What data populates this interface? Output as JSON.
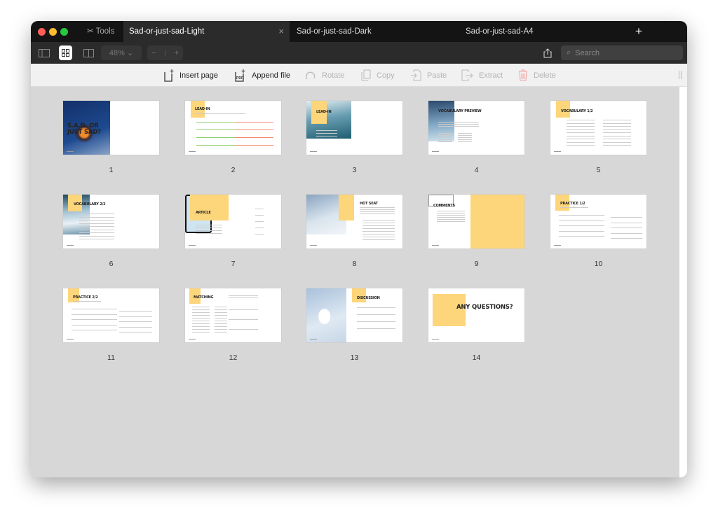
{
  "window": {
    "tabs": [
      {
        "label": "Tools",
        "icon": "tools-icon"
      },
      {
        "label": "Sad-or-just-sad-Light",
        "active": true
      },
      {
        "label": "Sad-or-just-sad-Dark"
      },
      {
        "label": "Sad-or-just-sad-A4"
      }
    ],
    "new_tab": "+",
    "close_tab": "×"
  },
  "toolbar": {
    "zoom": "48%",
    "zoom_out": "−",
    "zoom_in": "+",
    "search_placeholder": "Search",
    "view_mode": "grid"
  },
  "actions": [
    {
      "label": "Insert page",
      "icon": "insert-page-icon",
      "enabled": true
    },
    {
      "label": "Append file",
      "icon": "append-pdf-icon",
      "enabled": true
    },
    {
      "label": "Rotate",
      "icon": "rotate-icon",
      "enabled": false
    },
    {
      "label": "Copy",
      "icon": "copy-icon",
      "enabled": false
    },
    {
      "label": "Paste",
      "icon": "paste-icon",
      "enabled": false
    },
    {
      "label": "Extract",
      "icon": "extract-icon",
      "enabled": false
    },
    {
      "label": "Delete",
      "icon": "trash-icon",
      "enabled": false
    }
  ],
  "colors": {
    "accent_yellow": "#fdd57a",
    "delete_red": "#f3a3a3"
  },
  "pages": [
    {
      "number": "1",
      "title": "S.A.D. OR JUST SAD?"
    },
    {
      "number": "2",
      "title": "LEAD-IN"
    },
    {
      "number": "3",
      "title": "LEAD-IN"
    },
    {
      "number": "4",
      "title": "VOCABULARY PREVIEW"
    },
    {
      "number": "5",
      "title": "VOCABULARY 1/2"
    },
    {
      "number": "6",
      "title": "VOCABULARY 2/2"
    },
    {
      "number": "7",
      "title": "ARTICLE"
    },
    {
      "number": "8",
      "title": "HOT SEAT"
    },
    {
      "number": "9",
      "title": "COMMENTS"
    },
    {
      "number": "10",
      "title": "PRACTICE 1/2"
    },
    {
      "number": "11",
      "title": "PRACTICE 2/2"
    },
    {
      "number": "12",
      "title": "MATCHING"
    },
    {
      "number": "13",
      "title": "DISCUSSION"
    },
    {
      "number": "14",
      "title": "ANY QUESTIONS?"
    }
  ]
}
